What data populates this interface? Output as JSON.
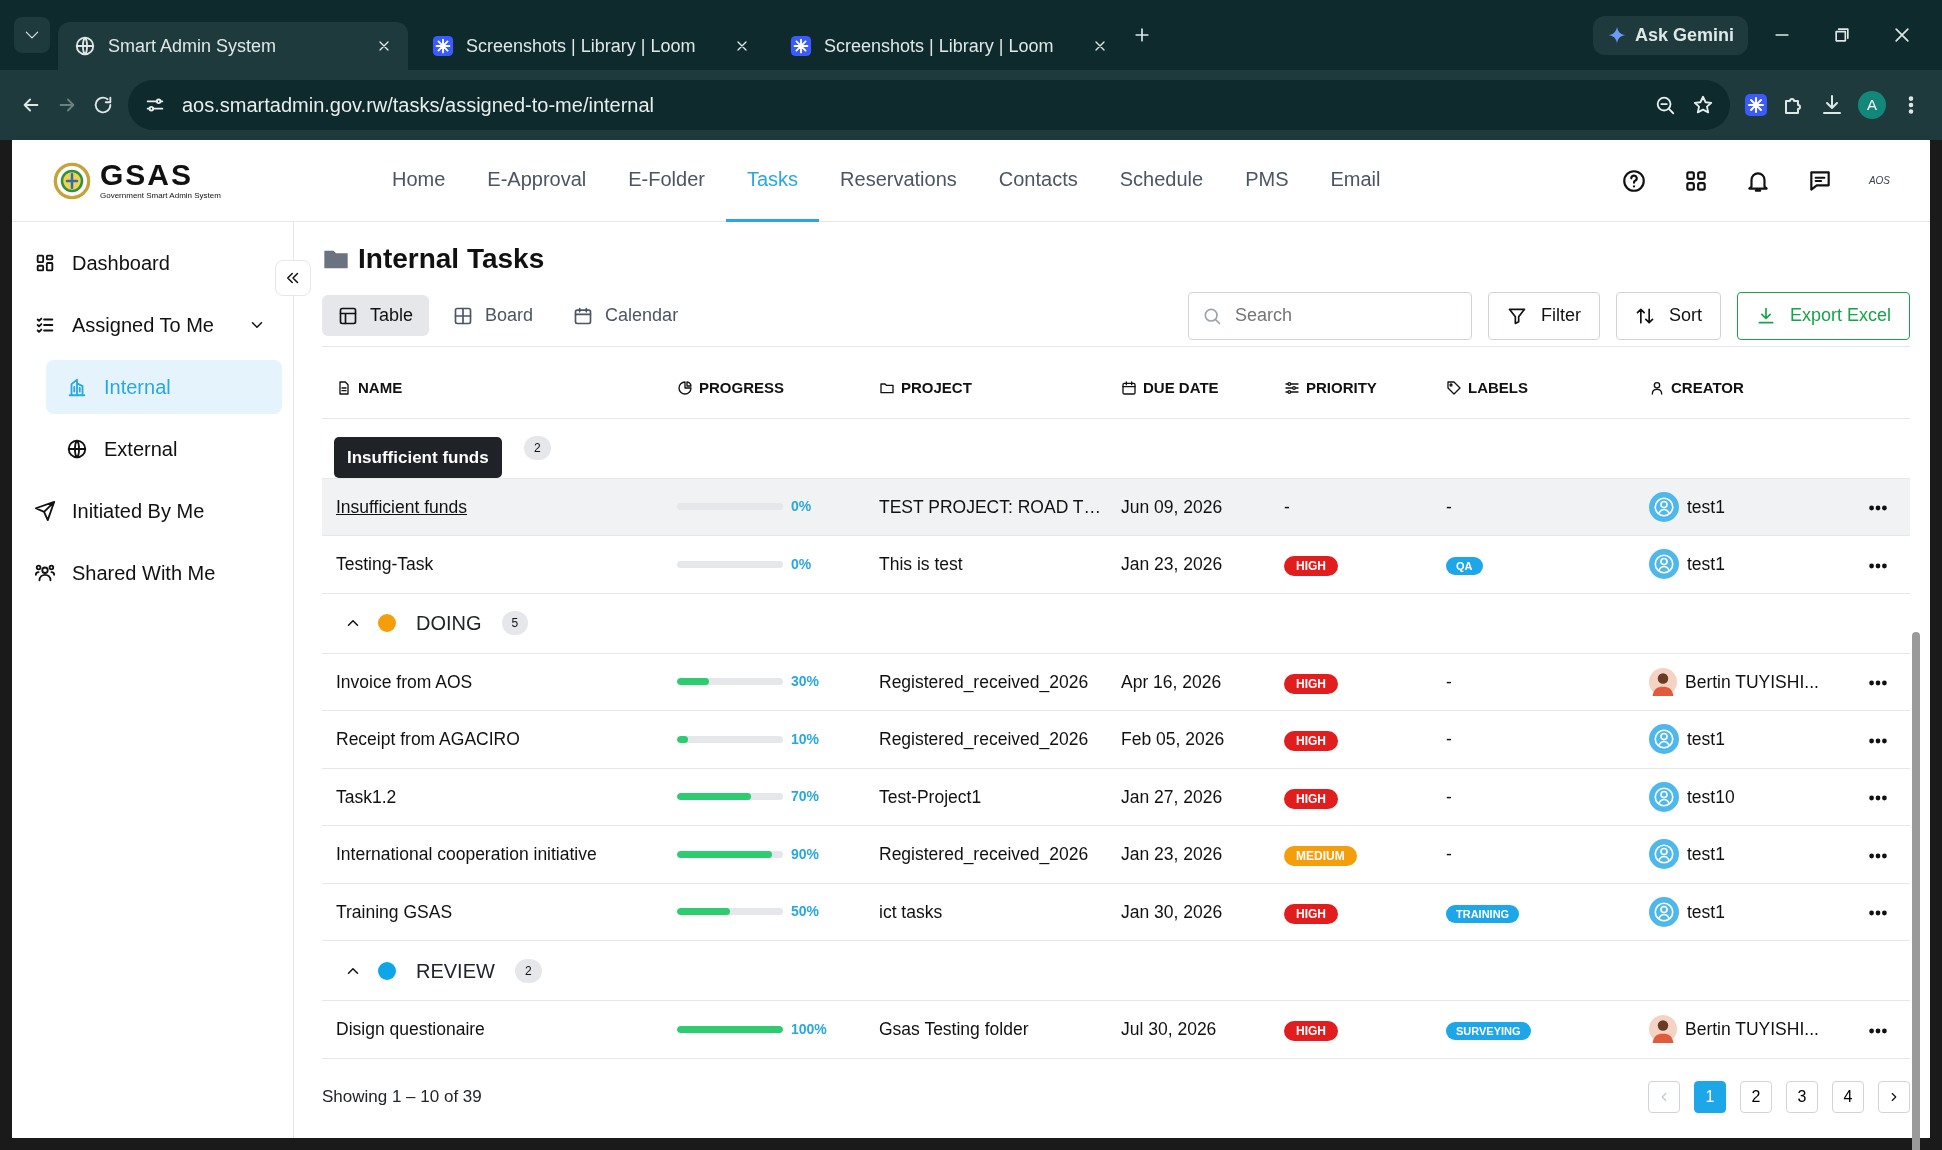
{
  "browser": {
    "tabs": [
      {
        "title": "Smart Admin System",
        "selected": true,
        "kind": "globe"
      },
      {
        "title": "Screenshots | Library | Loom",
        "selected": false,
        "kind": "loom"
      },
      {
        "title": "Screenshots | Library | Loom",
        "selected": false,
        "kind": "loom"
      }
    ],
    "gemini": "Ask Gemini",
    "url": "aos.smartadmin.gov.rw/tasks/assigned-to-me/internal",
    "profile": "A"
  },
  "app": {
    "logo": "GSAS",
    "logo_sub": "Government Smart Admin System",
    "nav": [
      {
        "label": "Home",
        "selected": false
      },
      {
        "label": "E-Approval",
        "selected": false
      },
      {
        "label": "E-Folder",
        "selected": false
      },
      {
        "label": "Tasks",
        "selected": true
      },
      {
        "label": "Reservations",
        "selected": false
      },
      {
        "label": "Contacts",
        "selected": false
      },
      {
        "label": "Schedule",
        "selected": false
      },
      {
        "label": "PMS",
        "selected": false
      },
      {
        "label": "Email",
        "selected": false
      }
    ],
    "user_mark": "AOS"
  },
  "sidebar": {
    "items": [
      {
        "label": "Dashboard",
        "kind": "dashboard",
        "selected": false
      },
      {
        "label": "Assigned To Me",
        "kind": "assigned",
        "selected": false,
        "expanded": true,
        "children": [
          {
            "label": "Internal",
            "kind": "building",
            "selected": true
          },
          {
            "label": "External",
            "kind": "globe",
            "selected": false
          }
        ]
      },
      {
        "label": "Initiated By Me",
        "kind": "send",
        "selected": false
      },
      {
        "label": "Shared With Me",
        "kind": "people",
        "selected": false
      }
    ]
  },
  "page": {
    "title": "Internal Tasks",
    "views": [
      {
        "label": "Table",
        "kind": "table",
        "selected": true
      },
      {
        "label": "Board",
        "kind": "board",
        "selected": false
      },
      {
        "label": "Calendar",
        "kind": "calendar",
        "selected": false
      }
    ],
    "search": {
      "placeholder": "Search"
    },
    "filter": "Filter",
    "sort": "Sort",
    "export": "Export Excel"
  },
  "table": {
    "columns": [
      {
        "label": "NAME",
        "kind": "doc"
      },
      {
        "label": "PROGRESS",
        "kind": "pie"
      },
      {
        "label": "PROJECT",
        "kind": "folder"
      },
      {
        "label": "DUE DATE",
        "kind": "calendar"
      },
      {
        "label": "PRIORITY",
        "kind": "sliders"
      },
      {
        "label": "LABELS",
        "kind": "tag"
      },
      {
        "label": "CREATOR",
        "kind": "user"
      }
    ],
    "groups": [
      {
        "count": "2",
        "rows": [
          {
            "name": "Insufficient funds",
            "hovered": true,
            "level": 0,
            "progress": "0%",
            "project": "TEST PROJECT: ROAD T…",
            "due": "Jun 09, 2026",
            "priority": {
              "text": "-"
            },
            "label": "-",
            "creator": {
              "name": "test1",
              "kind": "icon"
            }
          },
          {
            "name": "Testing-Task",
            "hovered": false,
            "level": 0,
            "progress": "0%",
            "project": "This is test",
            "due": "Jan 23, 2026",
            "priority": {
              "text": "HIGH",
              "kind": "high"
            },
            "label": "QA",
            "creator": {
              "name": "test1",
              "kind": "icon"
            }
          }
        ]
      },
      {
        "name": "DOING",
        "count": "5",
        "color": "#f59e0b",
        "expanded": true,
        "rows": [
          {
            "name": "Invoice from AOS",
            "hovered": false,
            "level": 0.3,
            "progress": "30%",
            "project": "Registered_received_2026",
            "due": "Apr 16, 2026",
            "priority": {
              "text": "HIGH",
              "kind": "high"
            },
            "label": "-",
            "creator": {
              "name": "Bertin TUYISHI...",
              "kind": "photo"
            }
          },
          {
            "name": "Receipt from AGACIRO",
            "hovered": false,
            "level": 0.1,
            "progress": "10%",
            "project": "Registered_received_2026",
            "due": "Feb 05, 2026",
            "priority": {
              "text": "HIGH",
              "kind": "high"
            },
            "label": "-",
            "creator": {
              "name": "test1",
              "kind": "icon"
            }
          },
          {
            "name": "Task1.2",
            "hovered": false,
            "level": 0.7,
            "progress": "70%",
            "project": "Test-Project1",
            "due": "Jan 27, 2026",
            "priority": {
              "text": "HIGH",
              "kind": "high"
            },
            "label": "-",
            "creator": {
              "name": "test10",
              "kind": "icon"
            }
          },
          {
            "name": "International cooperation initiative",
            "hovered": false,
            "level": 0.9,
            "progress": "90%",
            "project": "Registered_received_2026",
            "due": "Jan 23, 2026",
            "priority": {
              "text": "MEDIUM",
              "kind": "medium"
            },
            "label": "-",
            "creator": {
              "name": "test1",
              "kind": "icon"
            }
          },
          {
            "name": "Training GSAS",
            "hovered": false,
            "level": 0.5,
            "progress": "50%",
            "project": "ict tasks",
            "due": "Jan 30, 2026",
            "priority": {
              "text": "HIGH",
              "kind": "high"
            },
            "label": "TRAINING",
            "creator": {
              "name": "test1",
              "kind": "icon"
            }
          }
        ]
      },
      {
        "name": "REVIEW",
        "count": "2",
        "color": "#0ea5e9",
        "expanded": true,
        "rows": [
          {
            "name": "Disign questionaire",
            "hovered": false,
            "level": 1,
            "progress": "100%",
            "project": "Gsas Testing folder",
            "due": "Jul 30, 2026",
            "priority": {
              "text": "HIGH",
              "kind": "high"
            },
            "label": "SURVEYING",
            "creator": {
              "name": "Bertin TUYISHI...",
              "kind": "photo"
            }
          }
        ]
      }
    ],
    "tooltip": "Insufficient funds"
  },
  "footer": {
    "showing": "Showing 1 – 10 of 39",
    "pages": [
      {
        "label": "1",
        "selected": true
      },
      {
        "label": "2",
        "selected": false
      },
      {
        "label": "3",
        "selected": false
      },
      {
        "label": "4",
        "selected": false
      }
    ],
    "prev_disabled": true,
    "next_disabled": false
  }
}
